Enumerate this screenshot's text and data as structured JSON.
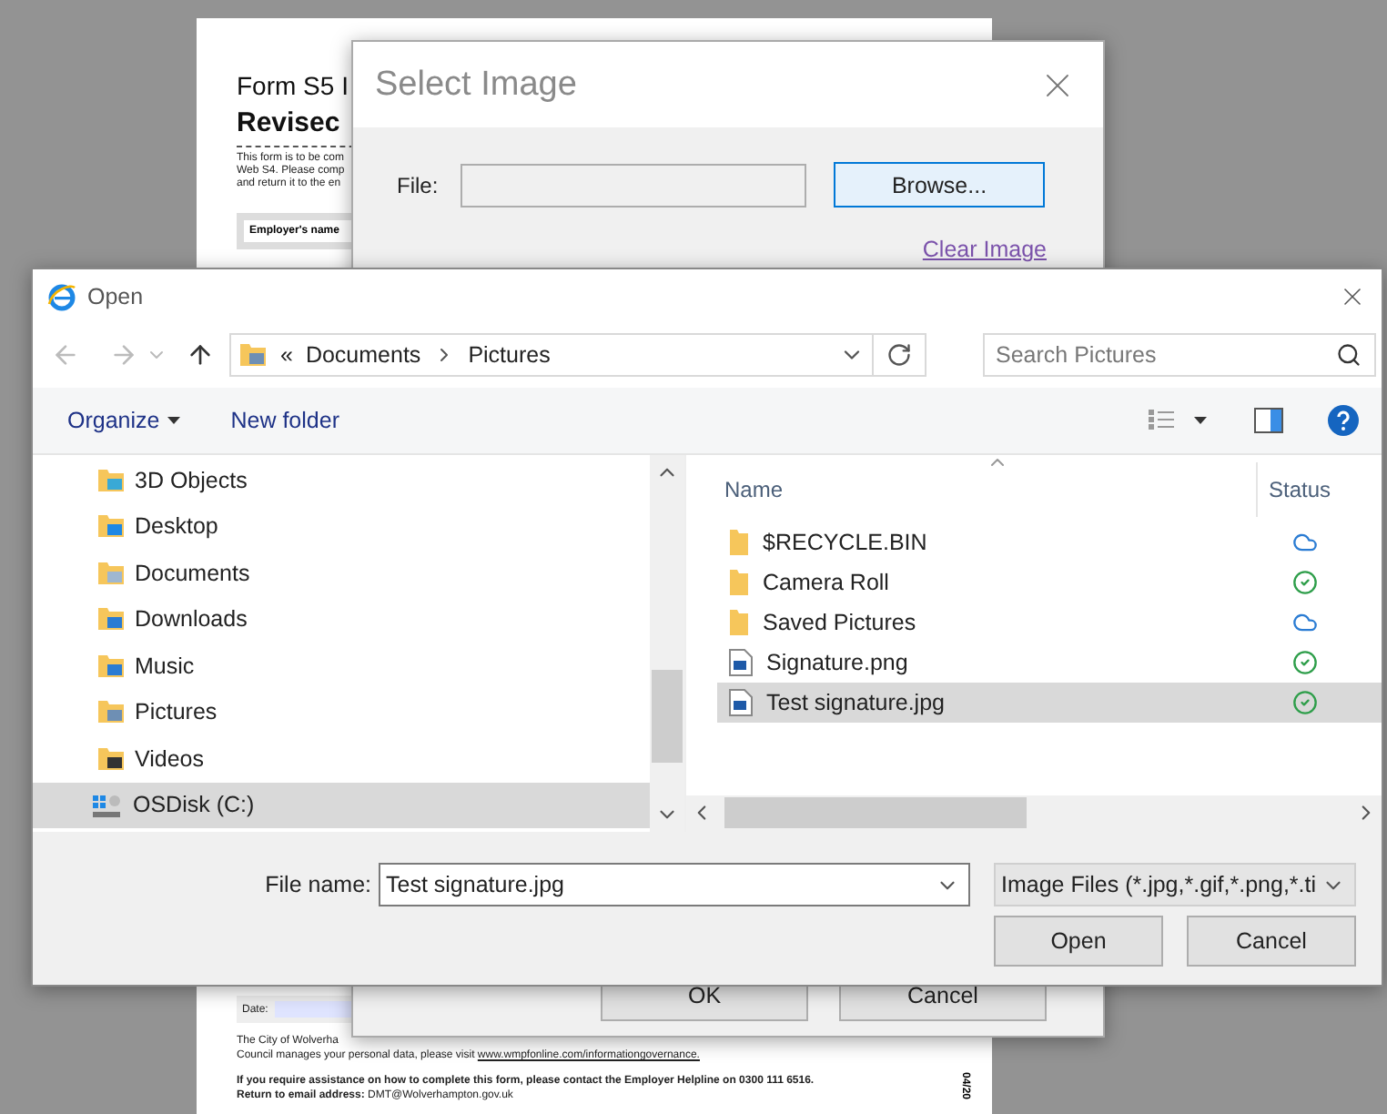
{
  "document": {
    "title_line": "Form S5 I",
    "heading": "Revisec",
    "intro_lines": [
      "This form is to be com",
      "Web S4. Please comp",
      "and return it to the en"
    ],
    "employer_label": "Employer's name",
    "date_label": "Date:",
    "privacy_line": "The City of Wolverha",
    "privacy_text": "Council manages your personal data, please visit ",
    "privacy_link": "www.wmpfonline.com/informationgovernance.",
    "help_lines": [
      "**If you require assistance on how to complete this form, please contact the Employer Helpline on 0300 111 6516.**",
      "**Return to email address:** DMT@Wolverhampton.gov.uk"
    ],
    "version": "04/20"
  },
  "select_dialog": {
    "title": "Select Image",
    "file_label": "File:",
    "browse": "Browse...",
    "clear_link": "Clear Image",
    "buttons": [
      "OK",
      "Cancel"
    ]
  },
  "open_dialog": {
    "title": "Open",
    "overflow": "«",
    "breadcrumb": [
      "Documents",
      "Pictures"
    ],
    "search": {
      "placeholder": "Search Pictures"
    },
    "toolbar": {
      "organize": "Organize",
      "new_folder": "New folder"
    },
    "nav_items": [
      {
        "label": "3D Objects",
        "kind": "objects",
        "selected": false
      },
      {
        "label": "Desktop",
        "kind": "desktop",
        "selected": false
      },
      {
        "label": "Documents",
        "kind": "documents",
        "selected": false
      },
      {
        "label": "Downloads",
        "kind": "downloads",
        "selected": false
      },
      {
        "label": "Music",
        "kind": "music",
        "selected": false
      },
      {
        "label": "Pictures",
        "kind": "pictures",
        "selected": false
      },
      {
        "label": "Videos",
        "kind": "videos",
        "selected": false
      },
      {
        "label": "OSDisk (C:)",
        "kind": "drive",
        "selected": true
      }
    ],
    "columns": [
      "Name",
      "Status"
    ],
    "files": [
      {
        "name": "$RECYCLE.BIN",
        "kind": "folder",
        "on_device": false,
        "selected": false
      },
      {
        "name": "Camera Roll",
        "kind": "folder",
        "on_device": true,
        "selected": false
      },
      {
        "name": "Saved Pictures",
        "kind": "folder",
        "on_device": false,
        "selected": false
      },
      {
        "name": "Signature.png",
        "kind": "image",
        "on_device": true,
        "selected": false
      },
      {
        "name": "Test signature.jpg",
        "kind": "image",
        "on_device": true,
        "selected": true
      }
    ],
    "file_name_label": "File name:",
    "file_name": "Test signature.jpg",
    "file_type": "Image Files (*.jpg,*.gif,*.png,*.ti",
    "buttons": [
      "Open",
      "Cancel"
    ]
  }
}
